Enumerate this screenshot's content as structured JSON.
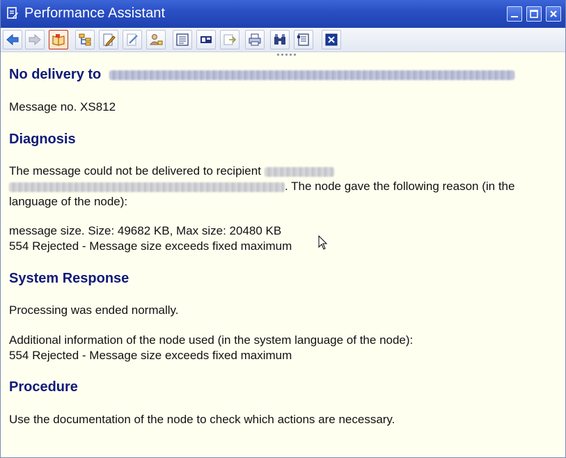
{
  "window": {
    "title": "Performance Assistant",
    "icons": [
      "document-edit-icon",
      "minimize-icon",
      "maximize-icon",
      "close-icon"
    ]
  },
  "toolbar": {
    "buttons": [
      {
        "name": "back-button",
        "icon": "arrow-left-icon"
      },
      {
        "name": "forward-button",
        "icon": "arrow-right-icon"
      },
      {
        "name": "technical-info-button",
        "icon": "book-open-icon"
      },
      {
        "name": "structure-button",
        "icon": "hierarchy-icon"
      },
      {
        "name": "edit-button",
        "icon": "pencil-icon"
      },
      {
        "name": "link-button",
        "icon": "link-icon"
      },
      {
        "name": "user-button",
        "icon": "user-icon"
      },
      {
        "name": "text-button",
        "icon": "text-page-icon"
      },
      {
        "name": "table-button",
        "icon": "table-icon"
      },
      {
        "name": "export-button",
        "icon": "export-icon"
      },
      {
        "name": "print-button",
        "icon": "printer-icon"
      },
      {
        "name": "find-button",
        "icon": "binoculars-icon"
      },
      {
        "name": "settings-button",
        "icon": "settings-page-icon"
      },
      {
        "name": "close-button",
        "icon": "close-x-icon"
      }
    ]
  },
  "message": {
    "heading_prefix": "No delivery to",
    "message_no": "Message no. XS812",
    "diagnosis_title": "Diagnosis",
    "diagnosis_text_1": "The message could not be delivered to recipient",
    "diagnosis_text_2": ". The node gave the following reason (in the",
    "diagnosis_text_3": "language of the node):",
    "reason_line_1": "message size. Size: 49682 KB, Max size: 20480 KB",
    "reason_line_2": "554 Rejected - Message size exceeds fixed maximum",
    "system_response_title": "System Response",
    "system_response_text": "Processing was ended normally.",
    "additional_info_1": "Additional information of the node used (in the system language of the node):",
    "additional_info_2": "554 Rejected - Message size exceeds fixed maximum",
    "procedure_title": "Procedure",
    "procedure_text": "Use the documentation of the node to check which actions are necessary."
  },
  "colors": {
    "title_bar": "#2a4fc4",
    "background": "#fffff0",
    "heading": "#101a7a"
  }
}
